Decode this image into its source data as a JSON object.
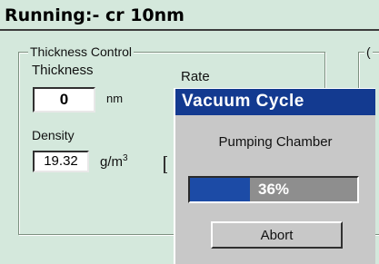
{
  "window": {
    "title": "Running:- cr 10nm"
  },
  "thickness_control": {
    "legend": "Thickness Control",
    "thickness_label": "Thickness",
    "thickness_value": "0",
    "thickness_unit": "nm",
    "rate_label": "Rate",
    "density_label": "Density",
    "density_value": "19.32",
    "density_unit": "g/m",
    "density_unit_sup": "3"
  },
  "right_group": {
    "legend_fragment": "("
  },
  "vacuum_dialog": {
    "title": "Vacuum Cycle",
    "status": "Pumping Chamber",
    "progress_percent": 36,
    "progress_label": "36%",
    "abort_label": "Abort"
  },
  "colors": {
    "background": "#d4e8dc",
    "dialog_title_bar": "#133a90",
    "progress_fill": "#1c4ba6"
  }
}
